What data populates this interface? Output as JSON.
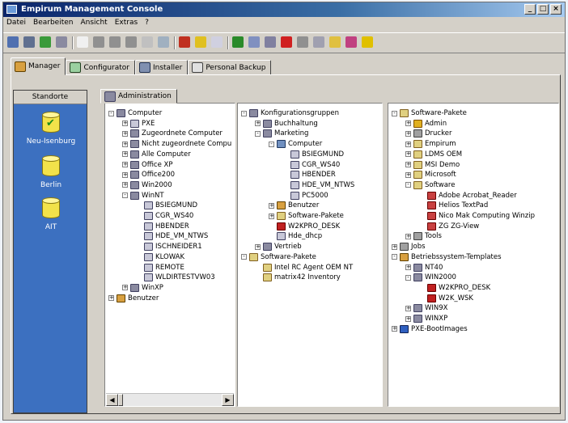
{
  "window": {
    "title": "Empirum Management Console"
  },
  "window_buttons": [
    "_",
    "□",
    "×"
  ],
  "menu": [
    "Datei",
    "Bearbeiten",
    "Ansicht",
    "Extras",
    "?"
  ],
  "tabs": [
    {
      "label": "Manager",
      "active": true
    },
    {
      "label": "Configurator",
      "active": false
    },
    {
      "label": "Installer",
      "active": false
    },
    {
      "label": "Personal Backup",
      "active": false
    }
  ],
  "standorte": {
    "header": "Standorte",
    "sites": [
      "Neu-Isenburg",
      "Berlin",
      "AIT"
    ]
  },
  "admin_tab": "Administration",
  "tree1": [
    {
      "label": "Computer",
      "icon": "network-icon",
      "level": 0,
      "exp": "-"
    },
    {
      "label": "PXE",
      "icon": "pc-icon",
      "level": 1,
      "exp": "+"
    },
    {
      "label": "Zugeordnete Computer",
      "icon": "network-icon",
      "level": 1,
      "exp": "+"
    },
    {
      "label": "Nicht zugeordnete Compu",
      "icon": "network-icon",
      "level": 1,
      "exp": "+"
    },
    {
      "label": "Alle Computer",
      "icon": "network-icon",
      "level": 1,
      "exp": "+"
    },
    {
      "label": "Office XP",
      "icon": "network-icon",
      "level": 1,
      "exp": "+"
    },
    {
      "label": "Office200",
      "icon": "network-icon",
      "level": 1,
      "exp": "+"
    },
    {
      "label": "Win2000",
      "icon": "network-icon",
      "level": 1,
      "exp": "+"
    },
    {
      "label": "WinNT",
      "icon": "network-icon",
      "level": 1,
      "exp": "-"
    },
    {
      "label": "BSIEGMUND",
      "icon": "pc-icon",
      "level": 2,
      "exp": ""
    },
    {
      "label": "CGR_WS40",
      "icon": "pc-icon",
      "level": 2,
      "exp": ""
    },
    {
      "label": "HBENDER",
      "icon": "pc-icon",
      "level": 2,
      "exp": ""
    },
    {
      "label": "HDE_VM_NTWS",
      "icon": "pc-icon",
      "level": 2,
      "exp": ""
    },
    {
      "label": "ISCHNEIDER1",
      "icon": "pc-icon",
      "level": 2,
      "exp": ""
    },
    {
      "label": "KLOWAK",
      "icon": "pc-icon",
      "level": 2,
      "exp": ""
    },
    {
      "label": "REMOTE",
      "icon": "pc-icon",
      "level": 2,
      "exp": ""
    },
    {
      "label": "WLDIRTESTVW03",
      "icon": "pc-icon",
      "level": 2,
      "exp": ""
    },
    {
      "label": "WinXP",
      "icon": "network-icon",
      "level": 1,
      "exp": "+"
    },
    {
      "label": "Benutzer",
      "icon": "user-icon",
      "level": 0,
      "exp": "+"
    }
  ],
  "tree2": [
    {
      "label": "Konfigurationsgruppen",
      "icon": "network-icon",
      "level": 0,
      "exp": "-"
    },
    {
      "label": "Buchhaltung",
      "icon": "network-icon",
      "level": 1,
      "exp": "+"
    },
    {
      "label": "Marketing",
      "icon": "network-icon",
      "level": 1,
      "exp": "-"
    },
    {
      "label": "Computer",
      "icon": "group-icon",
      "level": 2,
      "exp": "-"
    },
    {
      "label": "BSIEGMUND",
      "icon": "pc-icon",
      "level": 3,
      "exp": ""
    },
    {
      "label": "CGR_WS40",
      "icon": "pc-icon",
      "level": 3,
      "exp": ""
    },
    {
      "label": "HBENDER",
      "icon": "pc-icon",
      "level": 3,
      "exp": ""
    },
    {
      "label": "HDE_VM_NTWS",
      "icon": "pc-icon",
      "level": 3,
      "exp": ""
    },
    {
      "label": "PC5000",
      "icon": "pc-icon",
      "level": 3,
      "exp": ""
    },
    {
      "label": "Benutzer",
      "icon": "user-icon",
      "level": 2,
      "exp": "+"
    },
    {
      "label": "Software-Pakete",
      "icon": "package-icon",
      "level": 2,
      "exp": "+"
    },
    {
      "label": "W2KPRO_DESK",
      "icon": "profile-icon",
      "level": 2,
      "exp": ""
    },
    {
      "label": "Hde_dhcp",
      "icon": "pc-icon",
      "level": 2,
      "exp": ""
    },
    {
      "label": "Vertrieb",
      "icon": "network-icon",
      "level": 1,
      "exp": "+"
    },
    {
      "label": "Software-Pakete",
      "icon": "package-icon",
      "level": 0,
      "exp": "-"
    },
    {
      "label": "Intel RC Agent OEM NT",
      "icon": "package-icon",
      "level": 1,
      "exp": ""
    },
    {
      "label": "matrix42 Inventory",
      "icon": "package-icon",
      "level": 1,
      "exp": ""
    }
  ],
  "tree3": [
    {
      "label": "Software-Pakete",
      "icon": "package-icon",
      "level": 0,
      "exp": "-"
    },
    {
      "label": "Admin",
      "icon": "key-icon",
      "level": 1,
      "exp": "+"
    },
    {
      "label": "Drucker",
      "icon": "printer-icon",
      "level": 1,
      "exp": "+"
    },
    {
      "label": "Empirum",
      "icon": "package-icon",
      "level": 1,
      "exp": "+"
    },
    {
      "label": "LDMS OEM",
      "icon": "package-icon",
      "level": 1,
      "exp": "+"
    },
    {
      "label": "MSI Demo",
      "icon": "package-icon",
      "level": 1,
      "exp": "+"
    },
    {
      "label": "Microsoft",
      "icon": "package-icon",
      "level": 1,
      "exp": "+"
    },
    {
      "label": "Software",
      "icon": "package-icon",
      "level": 1,
      "exp": "-"
    },
    {
      "label": "Adobe Acrobat_Reader",
      "icon": "app-icon",
      "level": 2,
      "exp": ""
    },
    {
      "label": "Helios TextPad",
      "icon": "app-icon",
      "level": 2,
      "exp": ""
    },
    {
      "label": "Nico Mak Computing Winzip",
      "icon": "app-icon",
      "level": 2,
      "exp": ""
    },
    {
      "label": "ZG ZG-View",
      "icon": "app-icon",
      "level": 2,
      "exp": ""
    },
    {
      "label": "Tools",
      "icon": "tool-icon",
      "level": 1,
      "exp": "+"
    },
    {
      "label": "Jobs",
      "icon": "tool-icon",
      "level": 0,
      "exp": "+"
    },
    {
      "label": "Betriebssystem-Templates",
      "icon": "user-icon",
      "level": 0,
      "exp": "-"
    },
    {
      "label": "NT40",
      "icon": "network-icon",
      "level": 1,
      "exp": "+"
    },
    {
      "label": "WIN2000",
      "icon": "network-icon",
      "level": 1,
      "exp": "-"
    },
    {
      "label": "W2KPRO_DESK",
      "icon": "profile-icon",
      "level": 2,
      "exp": ""
    },
    {
      "label": "W2K_WSK",
      "icon": "profile-icon",
      "level": 2,
      "exp": ""
    },
    {
      "label": "WIN9X",
      "icon": "network-icon",
      "level": 1,
      "exp": "+"
    },
    {
      "label": "WINXP",
      "icon": "network-icon",
      "level": 1,
      "exp": "+"
    },
    {
      "label": "PXE-BootImages",
      "icon": "windows-icon",
      "level": 0,
      "exp": "+"
    }
  ],
  "toolbar_icons": [
    "console-icon",
    "connect-icon",
    "network-icon",
    "network-alt-icon",
    "new-icon",
    "cut-icon",
    "copy-icon",
    "paste-icon",
    "delete-icon",
    "properties-icon",
    "alert-icon",
    "star-icon",
    "schedule-icon",
    "tree-icon",
    "settings-icon",
    "image-icon",
    "stop-icon",
    "printer-icon",
    "report-icon",
    "jobs-icon",
    "favorite-icon",
    "help-icon"
  ],
  "colors": {
    "title_start": "#0a246a",
    "title_end": "#a6caf0",
    "sidebar": "#3c70c0",
    "site_icon": "#f2e24a"
  }
}
